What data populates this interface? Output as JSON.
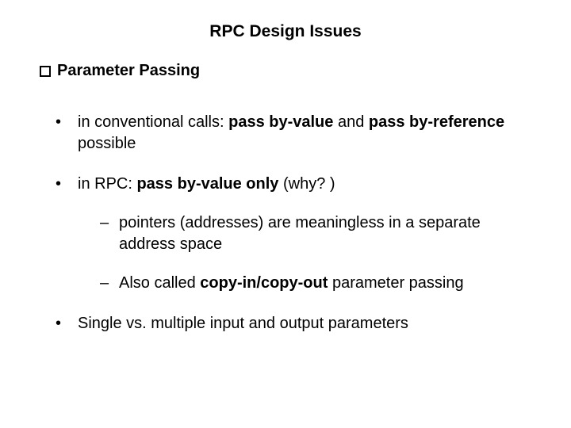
{
  "title": "RPC Design Issues",
  "section": "Parameter Passing",
  "bullets": {
    "b1_pre": "in conventional calls: ",
    "b1_bold1": "pass by-value",
    "b1_mid": " and ",
    "b1_bold2": "pass by-reference",
    "b1_post": " possible",
    "b2_pre": "in RPC: ",
    "b2_bold": "pass by-value only",
    "b2_post": " (why? )",
    "b2_sub1": "pointers (addresses) are meaningless in a separate address space",
    "b2_sub2_pre": "Also called ",
    "b2_sub2_bold": "copy-in/copy-out",
    "b2_sub2_post": " parameter passing",
    "b3": "Single vs. multiple input and output parameters"
  }
}
